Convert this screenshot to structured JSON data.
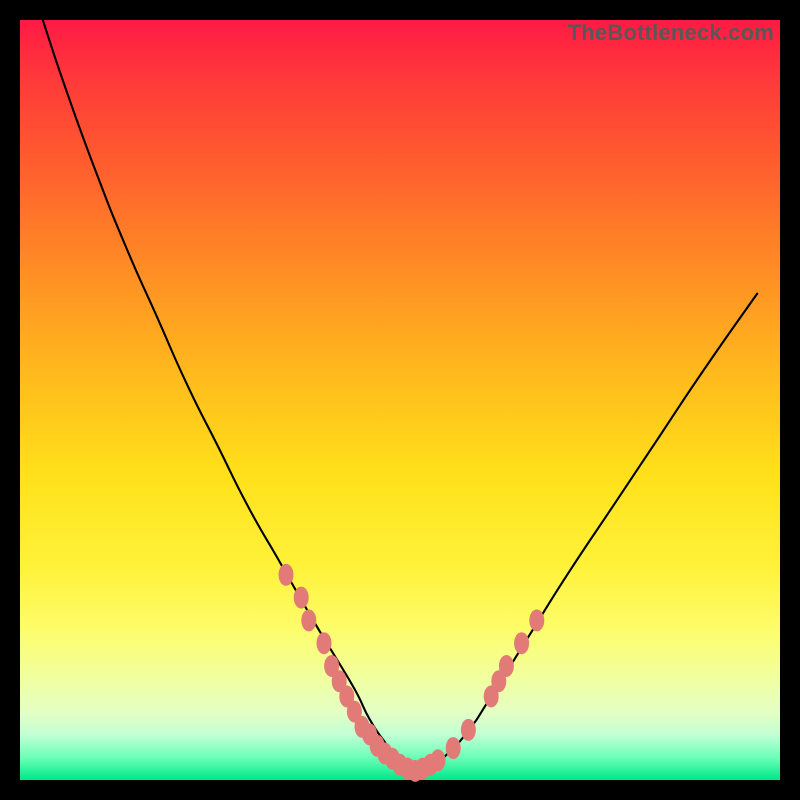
{
  "watermark": "TheBottleneck.com",
  "colors": {
    "gradient_top": "#ff1a44",
    "gradient_bottom": "#00e889",
    "marker": "#e27a77",
    "curve": "#000000",
    "frame": "#000000"
  },
  "chart_data": {
    "type": "line",
    "title": "",
    "xlabel": "",
    "ylabel": "",
    "xlim": [
      0,
      100
    ],
    "ylim": [
      0,
      100
    ],
    "grid": false,
    "legend": false,
    "notes": "V-shaped bottleneck curve. Background color encodes y-axis value (red=high, green=low). Minimum near x≈51. No axis tick labels are shown.",
    "series": [
      {
        "name": "bottleneck-curve",
        "x": [
          3,
          6,
          10,
          14,
          18,
          22,
          26,
          30,
          34,
          38,
          41,
          44,
          46,
          48,
          50,
          52,
          54,
          56,
          59,
          62,
          67,
          72,
          78,
          84,
          90,
          97
        ],
        "y": [
          100,
          91,
          80,
          70,
          61,
          52,
          44,
          36,
          29,
          22,
          17,
          12,
          8,
          5,
          2.5,
          1.2,
          1.6,
          3.2,
          6.5,
          11,
          19,
          27,
          36,
          45,
          54,
          64
        ]
      }
    ],
    "markers": {
      "name": "highlighted-points",
      "color": "#e27a77",
      "points": [
        {
          "x": 35,
          "y": 27
        },
        {
          "x": 37,
          "y": 24
        },
        {
          "x": 38,
          "y": 21
        },
        {
          "x": 40,
          "y": 18
        },
        {
          "x": 41,
          "y": 15
        },
        {
          "x": 42,
          "y": 13
        },
        {
          "x": 43,
          "y": 11
        },
        {
          "x": 44,
          "y": 9
        },
        {
          "x": 45,
          "y": 7
        },
        {
          "x": 46,
          "y": 6
        },
        {
          "x": 47,
          "y": 4.5
        },
        {
          "x": 48,
          "y": 3.5
        },
        {
          "x": 49,
          "y": 2.8
        },
        {
          "x": 50,
          "y": 2
        },
        {
          "x": 51,
          "y": 1.5
        },
        {
          "x": 52,
          "y": 1.2
        },
        {
          "x": 53,
          "y": 1.5
        },
        {
          "x": 54,
          "y": 2
        },
        {
          "x": 55,
          "y": 2.6
        },
        {
          "x": 57,
          "y": 4.2
        },
        {
          "x": 59,
          "y": 6.6
        },
        {
          "x": 62,
          "y": 11
        },
        {
          "x": 63,
          "y": 13
        },
        {
          "x": 64,
          "y": 15
        },
        {
          "x": 66,
          "y": 18
        },
        {
          "x": 68,
          "y": 21
        }
      ]
    }
  }
}
